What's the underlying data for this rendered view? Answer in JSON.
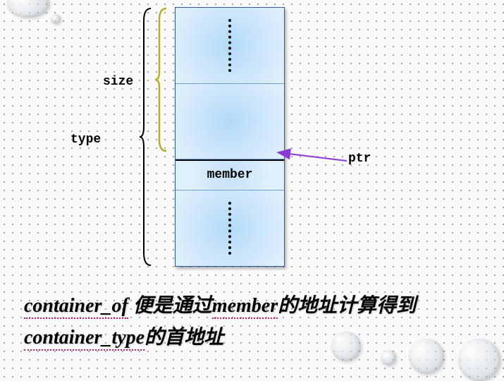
{
  "labels": {
    "size": "size",
    "type": "type",
    "ptr": "ptr",
    "member": "member"
  },
  "caption": {
    "code1": "container_of",
    "text1": " 便是通过",
    "code2": "member",
    "text2": "的地址计算得到",
    "code3": "container_type",
    "text3": "的首地址"
  },
  "colors": {
    "cell_fill": "#b3daf7",
    "cell_border": "#2a5a9a",
    "size_brace": "#e8a030",
    "type_brace": "#000000",
    "arrow": "#8a3ad6",
    "underline": "#d4145a"
  }
}
